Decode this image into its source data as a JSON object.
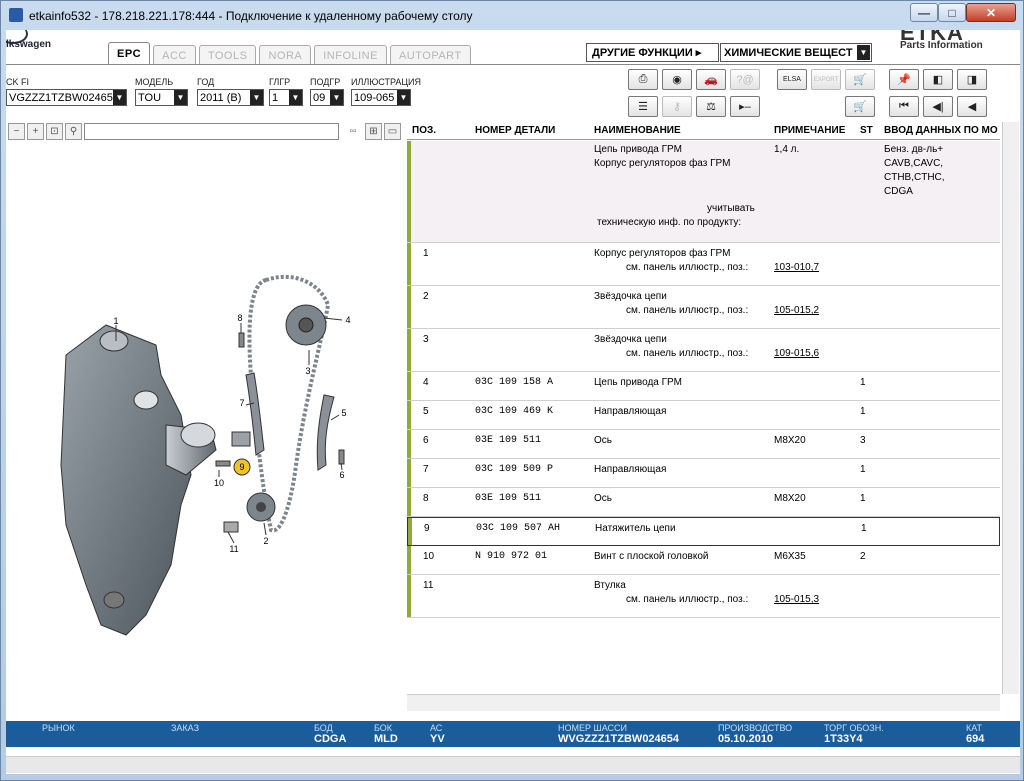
{
  "window": {
    "title": "etkainfo532 - 178.218.221.178:444 - Подключение к удаленному рабочему столу",
    "minimize": "—",
    "maximize": "□",
    "close": "✕"
  },
  "brand": {
    "vw_text": "lkswagen",
    "etka_big": "ETKA",
    "etka_small": "Parts Information"
  },
  "tabs": [
    {
      "label": "EPC",
      "active": true
    },
    {
      "label": "ACC",
      "active": false
    },
    {
      "label": "TOOLS",
      "active": false
    },
    {
      "label": "NORA",
      "active": false
    },
    {
      "label": "INFOLINE",
      "active": false
    },
    {
      "label": "AUTOPART",
      "active": false
    }
  ],
  "header": {
    "other_functions": "ДРУГИЕ ФУНКЦИИ ▸",
    "chem_select": "ХИМИЧЕСКИЕ ВЕЩЕСТ"
  },
  "filters": {
    "vin_label": "CK FI",
    "vin_value": "VGZZZ1TZBW02465",
    "model_label": "МОДЕЛЬ",
    "model_value": "TOU",
    "year_label": "ГОД",
    "year_value": "2011 (B)",
    "group_label": "ГЛГР",
    "group_value": "1",
    "subgroup_label": "ПОДГР",
    "subgroup_value": "09",
    "illustration_label": "ИЛЛЮСТРАЦИЯ",
    "illustration_value": "109-065"
  },
  "toolbar_icons": {
    "print": "⎙",
    "history": "◉",
    "car": "🚗",
    "help": "?@",
    "elsa": "ELSA",
    "export": "EXPORT",
    "cart_add": "🛒",
    "pin": "📌",
    "prev_page": "◧",
    "next_page": "◨",
    "list": "☰",
    "key": "⚷",
    "scale": "⚖",
    "play_minus": "▸–",
    "cart": "🛒",
    "first": "⏮",
    "back": "◀|",
    "prev": "◀"
  },
  "columns": {
    "pos": "ПОЗ.",
    "part_no": "НОМЕР ДЕТАЛИ",
    "name": "НАИМЕНОВАНИЕ",
    "note": "ПРИМЕЧАНИЕ",
    "st": "ST",
    "model_data": "ВВОД ДАННЫХ ПО МО"
  },
  "header_row": {
    "name1": "Цепь привода ГРМ",
    "name2": "Корпус регуляторов фаз ГРМ",
    "note": "1,4 л.",
    "model1": "Бенз. дв-ль+",
    "model2": "CAVB,CAVC,",
    "model3": "CTHB,CTHC,",
    "model4": "CDGA",
    "tech1": "учитывать",
    "tech2": "техническую инф. по продукту:"
  },
  "rows": [
    {
      "pos": "1",
      "part": "",
      "name": "Корпус регуляторов фаз ГРМ",
      "sub": "см. панель иллюстр., поз.:",
      "link": "103-010,7",
      "note": "",
      "st": ""
    },
    {
      "pos": "2",
      "part": "",
      "name": "Звёздочка цепи",
      "sub": "см. панель иллюстр., поз.:",
      "link": "105-015,2",
      "note": "",
      "st": ""
    },
    {
      "pos": "3",
      "part": "",
      "name": "Звёздочка цепи",
      "sub": "см. панель иллюстр., поз.:",
      "link": "109-015,6",
      "note": "",
      "st": ""
    },
    {
      "pos": "4",
      "part": "03C 109 158 A",
      "name": "Цепь привода ГРМ",
      "sub": "",
      "link": "",
      "note": "",
      "st": "1"
    },
    {
      "pos": "5",
      "part": "03C 109 469 K",
      "name": "Направляющая",
      "sub": "",
      "link": "",
      "note": "",
      "st": "1"
    },
    {
      "pos": "6",
      "part": "03E 109 511",
      "name": "Ось",
      "sub": "",
      "link": "",
      "note": "M8X20",
      "st": "3"
    },
    {
      "pos": "7",
      "part": "03C 109 509 P",
      "name": "Направляющая",
      "sub": "",
      "link": "",
      "note": "",
      "st": "1"
    },
    {
      "pos": "8",
      "part": "03E 109 511",
      "name": "Ось",
      "sub": "",
      "link": "",
      "note": "M8X20",
      "st": "1"
    },
    {
      "pos": "9",
      "part": "03C 109 507 AH",
      "name": "Натяжитель цепи",
      "sub": "",
      "link": "",
      "note": "",
      "st": "1"
    },
    {
      "pos": "10",
      "part": "N    910 972 01",
      "name": "Винт с плоской головкой",
      "sub": "",
      "link": "",
      "note": "M6X35",
      "st": "2"
    },
    {
      "pos": "11",
      "part": "",
      "name": "Втулка",
      "sub": "см. панель иллюстр., поз.:",
      "link": "105-015,3",
      "note": "",
      "st": ""
    }
  ],
  "callouts": [
    "1",
    "2",
    "3",
    "4",
    "5",
    "6",
    "7",
    "8",
    "9",
    "10",
    "11"
  ],
  "statusbar": {
    "market_label": "РЫНОК",
    "order_label": "ЗАКАЗ",
    "engine_label": "БОД",
    "engine_value": "CDGA",
    "gearbox_label": "БОК",
    "gearbox_value": "MLD",
    "ac_label": "АС",
    "ac_value": "YV",
    "chassis_label": "НОМЕР ШАССИ",
    "chassis_value": "WVGZZZ1TZBW024654",
    "prod_label": "ПРОИЗВОДСТВО",
    "prod_value": "05.10.2010",
    "trade_label": "ТОРГ ОБОЗН.",
    "trade_value": "1T33Y4",
    "cat_label": "КАТ",
    "cat_value": "694"
  }
}
